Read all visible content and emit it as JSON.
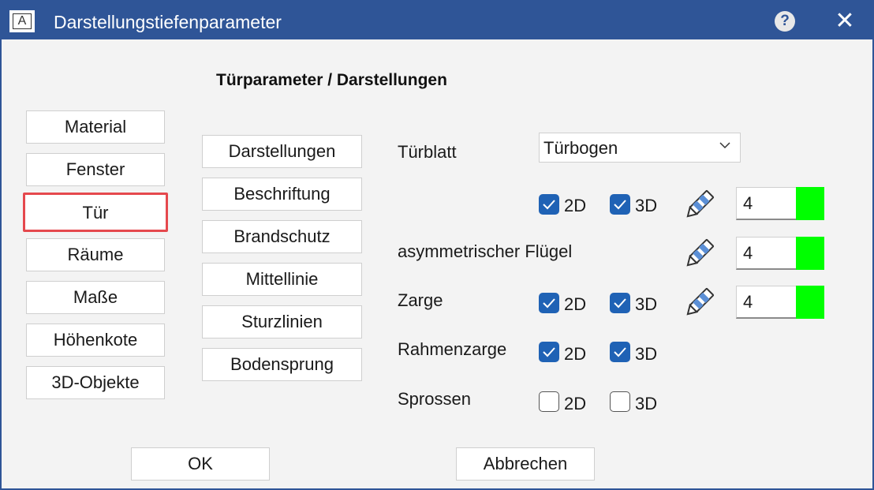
{
  "window": {
    "title": "Darstellungstiefenparameter",
    "app_icon_letter": "A",
    "help_label": "?",
    "close_label": "✕",
    "accent_color": "#2f5597"
  },
  "section_title": "Türparameter / Darstellungen",
  "categories": [
    {
      "label": "Material"
    },
    {
      "label": "Fenster"
    },
    {
      "label": "Tür",
      "selected": true
    },
    {
      "label": "Räume"
    },
    {
      "label": "Maße"
    },
    {
      "label": "Höhenkote"
    },
    {
      "label": "3D-Objekte"
    }
  ],
  "subcategories": [
    {
      "label": "Darstellungen"
    },
    {
      "label": "Beschriftung"
    },
    {
      "label": "Brandschutz"
    },
    {
      "label": "Mittellinie"
    },
    {
      "label": "Sturzlinien"
    },
    {
      "label": "Bodensprung"
    }
  ],
  "params": {
    "tuerblatt": {
      "label": "Türblatt",
      "select_value": "Türbogen",
      "check_2d": {
        "label": "2D",
        "checked": true
      },
      "check_3d": {
        "label": "3D",
        "checked": true
      },
      "pen_value": "4",
      "color": "#00ff00"
    },
    "fluegel": {
      "label": "asymmetrischer Flügel",
      "pen_value": "4",
      "color": "#00ff00"
    },
    "zarge": {
      "label": "Zarge",
      "check_2d": {
        "label": "2D",
        "checked": true
      },
      "check_3d": {
        "label": "3D",
        "checked": true
      },
      "pen_value": "4",
      "color": "#00ff00"
    },
    "rahmenzarge": {
      "label": "Rahmenzarge",
      "check_2d": {
        "label": "2D",
        "checked": true
      },
      "check_3d": {
        "label": "3D",
        "checked": true
      }
    },
    "sprossen": {
      "label": "Sprossen",
      "check_2d": {
        "label": "2D",
        "checked": false
      },
      "check_3d": {
        "label": "3D",
        "checked": false
      }
    }
  },
  "footer": {
    "ok_label": "OK",
    "cancel_label": "Abbrechen"
  }
}
